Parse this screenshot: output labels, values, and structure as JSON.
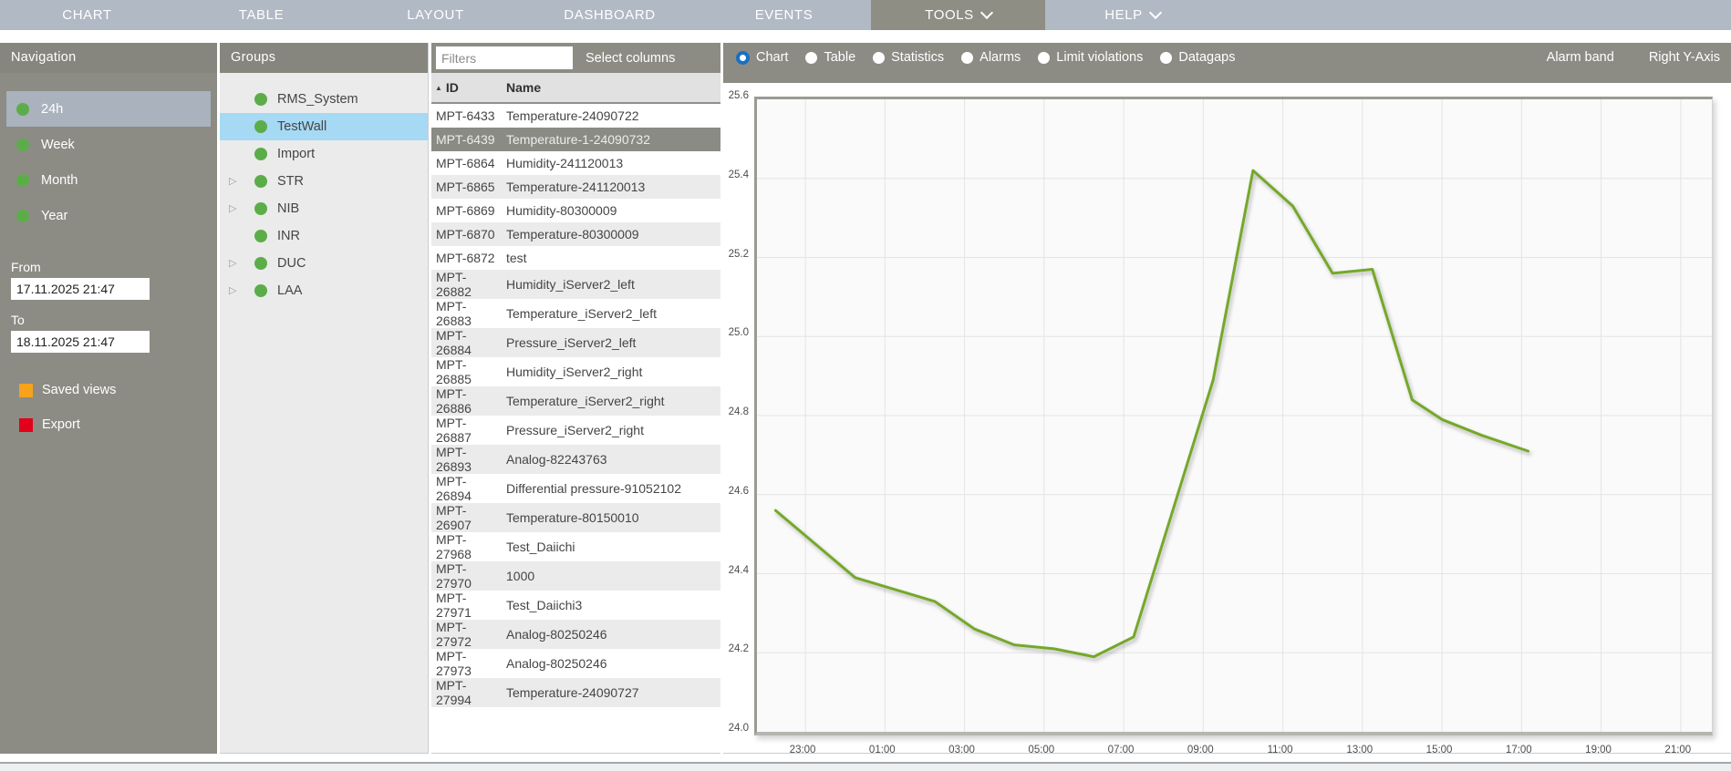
{
  "menu": {
    "items": [
      {
        "label": "CHART",
        "active": false,
        "dropdown": false
      },
      {
        "label": "TABLE",
        "active": false,
        "dropdown": false
      },
      {
        "label": "LAYOUT",
        "active": false,
        "dropdown": false
      },
      {
        "label": "DASHBOARD",
        "active": false,
        "dropdown": false
      },
      {
        "label": "EVENTS",
        "active": false,
        "dropdown": false
      },
      {
        "label": "TOOLS",
        "active": true,
        "dropdown": true
      },
      {
        "label": "HELP",
        "active": false,
        "dropdown": true
      }
    ]
  },
  "navigation": {
    "title": "Navigation",
    "ranges": [
      {
        "label": "24h",
        "selected": true
      },
      {
        "label": "Week",
        "selected": false
      },
      {
        "label": "Month",
        "selected": false
      },
      {
        "label": "Year",
        "selected": false
      }
    ],
    "from_label": "From",
    "from_value": "17.11.2025 21:47",
    "to_label": "To",
    "to_value": "18.11.2025 21:47",
    "actions": [
      {
        "label": "Saved views",
        "icon": "saved-views-icon",
        "color": "#f6a21d"
      },
      {
        "label": "Export",
        "icon": "export-icon",
        "color": "#e2001a"
      }
    ],
    "dot_color": "#5cad49"
  },
  "groups": {
    "title": "Groups",
    "items": [
      {
        "label": "RMS_System",
        "expandable": false,
        "selected": false
      },
      {
        "label": "TestWall",
        "expandable": false,
        "selected": true
      },
      {
        "label": "Import",
        "expandable": false,
        "selected": false
      },
      {
        "label": "STR",
        "expandable": true,
        "selected": false
      },
      {
        "label": "NIB",
        "expandable": true,
        "selected": false
      },
      {
        "label": "INR",
        "expandable": false,
        "selected": false
      },
      {
        "label": "DUC",
        "expandable": true,
        "selected": false
      },
      {
        "label": "LAA",
        "expandable": true,
        "selected": false
      }
    ],
    "selection_color": "#a6d9f4"
  },
  "sensor_table": {
    "filter_placeholder": "Filters",
    "select_columns_label": "Select columns",
    "columns": [
      {
        "label": "ID",
        "sorted": "asc"
      },
      {
        "label": "Name",
        "sorted": null
      }
    ],
    "rows": [
      {
        "id": "MPT-6433",
        "name": "Temperature-24090722",
        "selected": false
      },
      {
        "id": "MPT-6439",
        "name": "Temperature-1-24090732",
        "selected": true
      },
      {
        "id": "MPT-6864",
        "name": "Humidity-241120013",
        "selected": false
      },
      {
        "id": "MPT-6865",
        "name": "Temperature-241120013",
        "selected": false
      },
      {
        "id": "MPT-6869",
        "name": "Humidity-80300009",
        "selected": false
      },
      {
        "id": "MPT-6870",
        "name": "Temperature-80300009",
        "selected": false
      },
      {
        "id": "MPT-6872",
        "name": "test",
        "selected": false
      },
      {
        "id": "MPT-26882",
        "name": "Humidity_iServer2_left",
        "selected": false
      },
      {
        "id": "MPT-26883",
        "name": "Temperature_iServer2_left",
        "selected": false
      },
      {
        "id": "MPT-26884",
        "name": "Pressure_iServer2_left",
        "selected": false
      },
      {
        "id": "MPT-26885",
        "name": "Humidity_iServer2_right",
        "selected": false
      },
      {
        "id": "MPT-26886",
        "name": "Temperature_iServer2_right",
        "selected": false
      },
      {
        "id": "MPT-26887",
        "name": "Pressure_iServer2_right",
        "selected": false
      },
      {
        "id": "MPT-26893",
        "name": "Analog-82243763",
        "selected": false
      },
      {
        "id": "MPT-26894",
        "name": "Differential pressure-91052102",
        "selected": false
      },
      {
        "id": "MPT-26907",
        "name": "Temperature-80150010",
        "selected": false
      },
      {
        "id": "MPT-27968",
        "name": "Test_Daiichi",
        "selected": false
      },
      {
        "id": "MPT-27970",
        "name": "1000",
        "selected": false
      },
      {
        "id": "MPT-27971",
        "name": "Test_Daiichi3",
        "selected": false
      },
      {
        "id": "MPT-27972",
        "name": "Analog-80250246",
        "selected": false
      },
      {
        "id": "MPT-27973",
        "name": "Analog-80250246",
        "selected": false
      },
      {
        "id": "MPT-27994",
        "name": "Temperature-24090727",
        "selected": false
      }
    ]
  },
  "chart_toolbar": {
    "views": [
      {
        "label": "Chart",
        "selected": true
      },
      {
        "label": "Table",
        "selected": false
      },
      {
        "label": "Statistics",
        "selected": false
      },
      {
        "label": "Alarms",
        "selected": false
      },
      {
        "label": "Limit violations",
        "selected": false
      },
      {
        "label": "Datagaps",
        "selected": false
      }
    ],
    "buttons": [
      {
        "label": "Alarm band"
      },
      {
        "label": "Right Y-Axis"
      }
    ],
    "radio_selected_color": "#1a6fc4"
  },
  "chart_data": {
    "type": "line",
    "grid": true,
    "x_axis": {
      "start_time": "21:47",
      "duration_minutes": 1440,
      "tick_first": "23:00",
      "tick_interval_minutes": 120,
      "tick_labels": [
        "23:00",
        "01:00",
        "03:00",
        "05:00",
        "07:00",
        "09:00",
        "11:00",
        "13:00",
        "15:00",
        "17:00",
        "19:00",
        "21:00"
      ]
    },
    "y_axis": {
      "min": 24.0,
      "max": 25.6,
      "step": 0.2
    },
    "series": [
      {
        "name": "Temperature-1-24090732",
        "color": "#74a82c",
        "points": [
          {
            "time": "22:15",
            "value": 24.56
          },
          {
            "time": "00:15",
            "value": 24.39
          },
          {
            "time": "02:15",
            "value": 24.33
          },
          {
            "time": "03:15",
            "value": 24.26
          },
          {
            "time": "04:15",
            "value": 24.22
          },
          {
            "time": "05:15",
            "value": 24.21
          },
          {
            "time": "06:15",
            "value": 24.19
          },
          {
            "time": "07:15",
            "value": 24.24
          },
          {
            "time": "09:15",
            "value": 24.89
          },
          {
            "time": "10:15",
            "value": 25.42
          },
          {
            "time": "11:15",
            "value": 25.33
          },
          {
            "time": "12:15",
            "value": 25.16
          },
          {
            "time": "13:15",
            "value": 25.17
          },
          {
            "time": "14:15",
            "value": 24.84
          },
          {
            "time": "15:00",
            "value": 24.79
          },
          {
            "time": "16:00",
            "value": 24.75
          },
          {
            "time": "17:10",
            "value": 24.71
          }
        ]
      }
    ]
  }
}
